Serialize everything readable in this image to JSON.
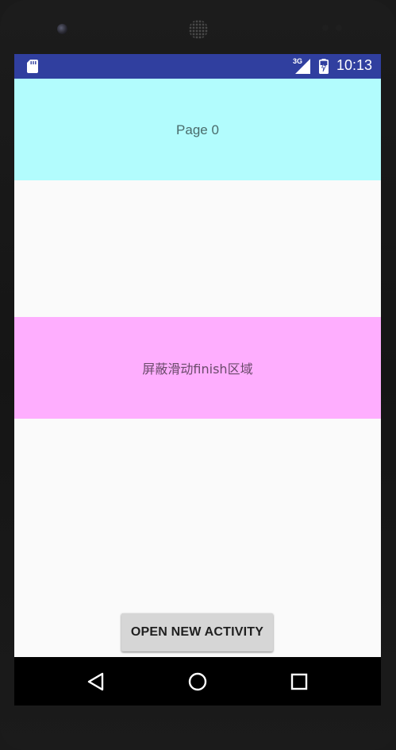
{
  "status_bar": {
    "time": "10:13",
    "network_type": "3G",
    "icons": [
      "sd-card-icon",
      "signal-icon",
      "battery-charging-icon"
    ],
    "background": "#303f9f"
  },
  "header_page": {
    "label": "Page 0",
    "background": "#b2fcfd"
  },
  "blocked_region": {
    "label": "屏蔽滑动finish区域",
    "background": "#feaefe"
  },
  "open_activity_button": {
    "label": "OPEN NEW ACTIVITY"
  },
  "nav_bar": {
    "icons": [
      "back-icon",
      "home-icon",
      "recents-icon"
    ]
  }
}
